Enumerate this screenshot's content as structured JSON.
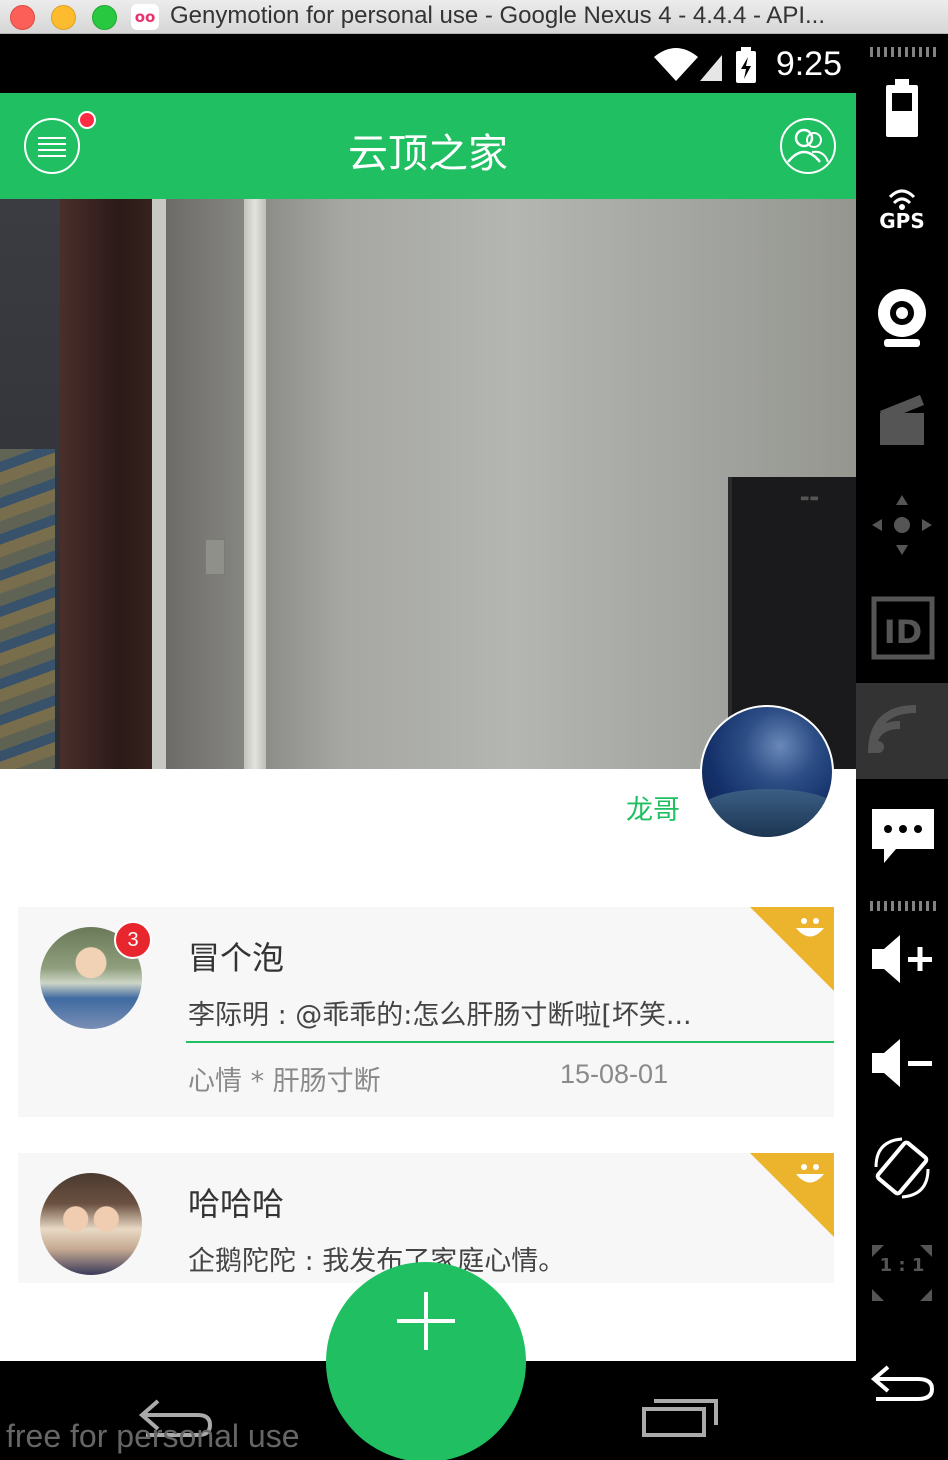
{
  "window": {
    "title": "Genymotion for personal use - Google Nexus 4 - 4.4.4 - API...",
    "logo_text": "oo"
  },
  "status_bar": {
    "time": "9:25"
  },
  "app": {
    "title": "云顶之家",
    "accent_color": "#1fbf62",
    "notification_dot_color": "#ff2a44"
  },
  "profile": {
    "name": "龙哥"
  },
  "feed": [
    {
      "title": "冒个泡",
      "badge": "3",
      "content": "李际明 : @乖乖的:怎么肝肠寸断啦[坏笑...",
      "tag": "心情  * 肝肠寸断",
      "date": "15-08-01"
    },
    {
      "title": "哈哈哈",
      "content": "企鹅陀陀 : 我发布了家庭心情。"
    }
  ],
  "corner_color": "#ebb42c",
  "fab": {
    "icon": "plus-icon"
  },
  "watermark": "free for personal use",
  "sidebar": {
    "gps_label": "GPS",
    "id_label": "ID",
    "ratio_label": "1 : 1"
  }
}
